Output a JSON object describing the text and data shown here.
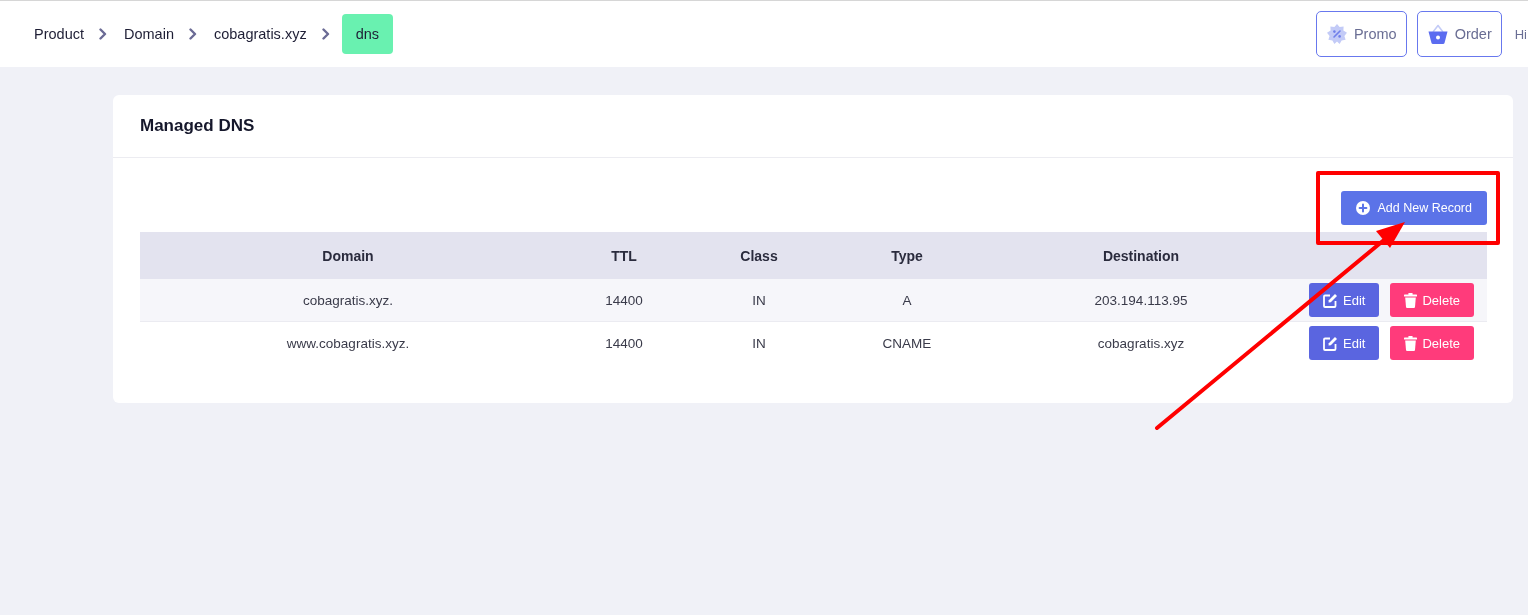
{
  "breadcrumb": [
    {
      "label": "Product",
      "selected": false
    },
    {
      "label": "Domain",
      "selected": false
    },
    {
      "label": "cobagratis.xyz",
      "selected": false
    },
    {
      "label": "dns",
      "selected": true
    }
  ],
  "header_actions": [
    {
      "kind": "promo",
      "label": "Promo"
    },
    {
      "kind": "order",
      "label": "Order"
    }
  ],
  "greeting": "Hi",
  "card": {
    "title": "Managed DNS",
    "add_button": "Add New Record",
    "table": {
      "columns": [
        "Domain",
        "TTL",
        "Class",
        "Type",
        "Destination"
      ],
      "rows": [
        {
          "cells": [
            "cobagratis.xyz.",
            "14400",
            "IN",
            "A",
            "203.194.113.95"
          ],
          "actions": [
            {
              "kind": "edit",
              "label": "Edit"
            },
            {
              "kind": "delete",
              "label": "Delete"
            }
          ]
        },
        {
          "cells": [
            "www.cobagratis.xyz.",
            "14400",
            "IN",
            "CNAME",
            "cobagratis.xyz"
          ],
          "actions": [
            {
              "kind": "edit",
              "label": "Edit"
            },
            {
              "kind": "delete",
              "label": "Delete"
            }
          ]
        }
      ]
    }
  }
}
